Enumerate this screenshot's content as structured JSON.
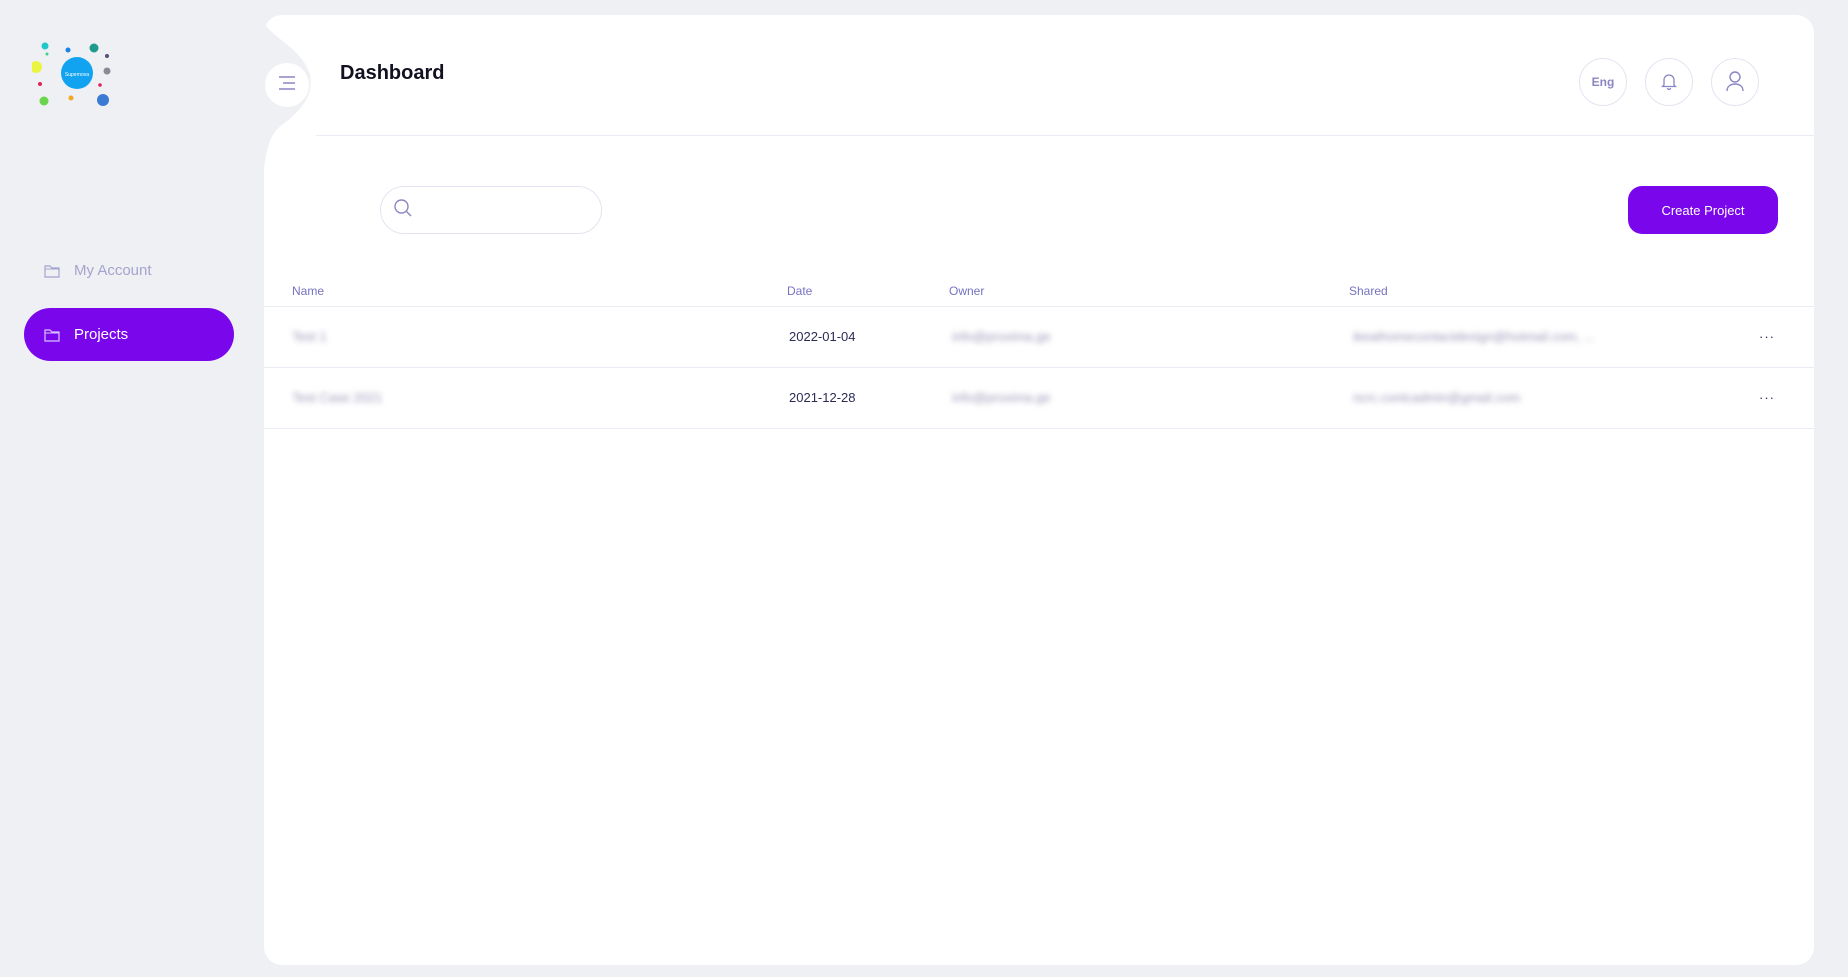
{
  "app": {
    "logo_text": "Supernova"
  },
  "sidebar": {
    "items": [
      {
        "label": "My Account",
        "icon": "folder-icon",
        "active": false
      },
      {
        "label": "Projects",
        "icon": "folder-icon",
        "active": true
      }
    ]
  },
  "header": {
    "title": "Dashboard",
    "language": "Eng"
  },
  "search": {
    "placeholder": "",
    "value": ""
  },
  "actions": {
    "create_label": "Create Project"
  },
  "table": {
    "columns": [
      "Name",
      "Date",
      "Owner",
      "Shared"
    ],
    "rows": [
      {
        "name": "Test 1",
        "date": "2022-01-04",
        "owner": "info@proxima.ge",
        "shared": "ikeathomecontactdesign@hotmail.com, ...",
        "more": "···"
      },
      {
        "name": "Test Case 2021",
        "date": "2021-12-28",
        "owner": "info@proxima.ge",
        "shared": "ncrc.contcadmin@gmail.com",
        "more": "···"
      }
    ]
  },
  "colors": {
    "accent": "#7a06ec",
    "background": "#eef0f3",
    "muted_text": "#a6a3cf",
    "header_text": "#7672c0"
  }
}
